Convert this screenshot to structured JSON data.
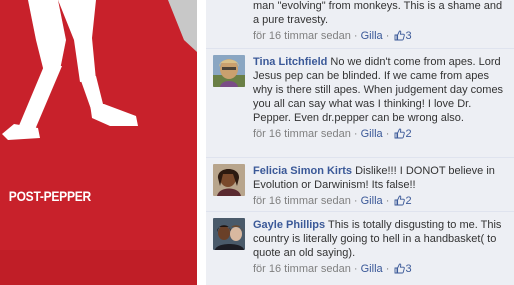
{
  "ad": {
    "caption": "POST-PEPPER",
    "bg_color": "#c8212b"
  },
  "comments": [
    {
      "author": "",
      "text": "man \"evolving\" from monkeys. This is a shame and a pure travesty.",
      "time": "för 16 timmar sedan",
      "sep": "·",
      "like_label": "Gilla",
      "like_icon": "thumbs-up-icon",
      "like_count": "3"
    },
    {
      "author": "Tina Litchfield",
      "text": "No we didn't come from apes. Lord Jesus pep can be blinded. If we came from apes why is there still apes. When judgement day comes you all can say what was I thinking! I love Dr. Pepper. Even dr.pepper can be wrong also.",
      "time": "för 16 timmar sedan",
      "sep": "·",
      "like_label": "Gilla",
      "like_icon": "thumbs-up-icon",
      "like_count": "2"
    },
    {
      "author": "Felicia Simon Kirts",
      "text": "Dislike!!! I DONOT believe in Evolution or Darwinism! Its false!!",
      "time": "för 16 timmar sedan",
      "sep": "·",
      "like_label": "Gilla",
      "like_icon": "thumbs-up-icon",
      "like_count": "2"
    },
    {
      "author": "Gayle Phillips",
      "text": "This is totally disgusting to me. This country is literally going to hell in a handbasket( to quote an old saying).",
      "time": "för 16 timmar sedan",
      "sep": "·",
      "like_label": "Gilla",
      "like_icon": "thumbs-up-icon",
      "like_count": "3"
    }
  ],
  "colors": {
    "link": "#3b5998",
    "meta": "#808080",
    "comment_bg": "#edeff4"
  }
}
